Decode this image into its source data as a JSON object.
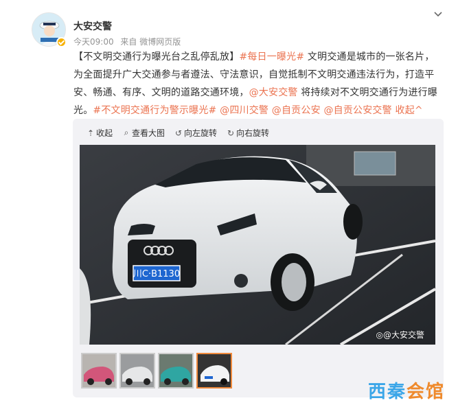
{
  "post": {
    "author": "大安交警",
    "time": "今天09:00",
    "source": "来自 微博网页版",
    "text": [
      {
        "t": "【不文明交通行为曝光台之乱停乱放】",
        "link": false
      },
      {
        "t": "#每日一曝光#",
        "link": true
      },
      {
        "t": " 文明交通是城市的一张名片，为全面提升广大交通参与者遵法、守法意识，自觉抵制不文明交通违法行为，打造平安、畅通、有序、文明的道路交通环境，",
        "link": false
      },
      {
        "t": "@大安交警",
        "link": true
      },
      {
        "t": " 将持续对不文明交通行为进行曝光。",
        "link": false
      },
      {
        "t": "#不文明交通行为警示曝光#",
        "link": true
      },
      {
        "t": " ",
        "link": false
      },
      {
        "t": "@四川交警",
        "link": true
      },
      {
        "t": " ",
        "link": false
      },
      {
        "t": "@自贡公安",
        "link": true
      },
      {
        "t": " ",
        "link": false
      },
      {
        "t": "@自贡公安交警",
        "link": true
      },
      {
        "t": " ",
        "link": false
      },
      {
        "t": "收起^",
        "link": true
      }
    ]
  },
  "media": {
    "tools": [
      {
        "icon": "collapse-icon",
        "glyph": "⇡",
        "label": "收起"
      },
      {
        "icon": "zoom-icon",
        "glyph": "⌕",
        "label": "查看大图"
      },
      {
        "icon": "rotate-left-icon",
        "glyph": "↺",
        "label": "向左旋转"
      },
      {
        "icon": "rotate-right-icon",
        "glyph": "↻",
        "label": "向右旋转"
      }
    ],
    "plate": "川C·B1130",
    "watermark": "@大安交警",
    "thumbnails": 4,
    "active_thumb": 4
  },
  "site_logo": {
    "part1": "西秦",
    "part2": "会馆"
  },
  "colors": {
    "link": "#eb7350",
    "active_thumb": "#f08a3c",
    "logo_blue": "#3ba6e8"
  }
}
